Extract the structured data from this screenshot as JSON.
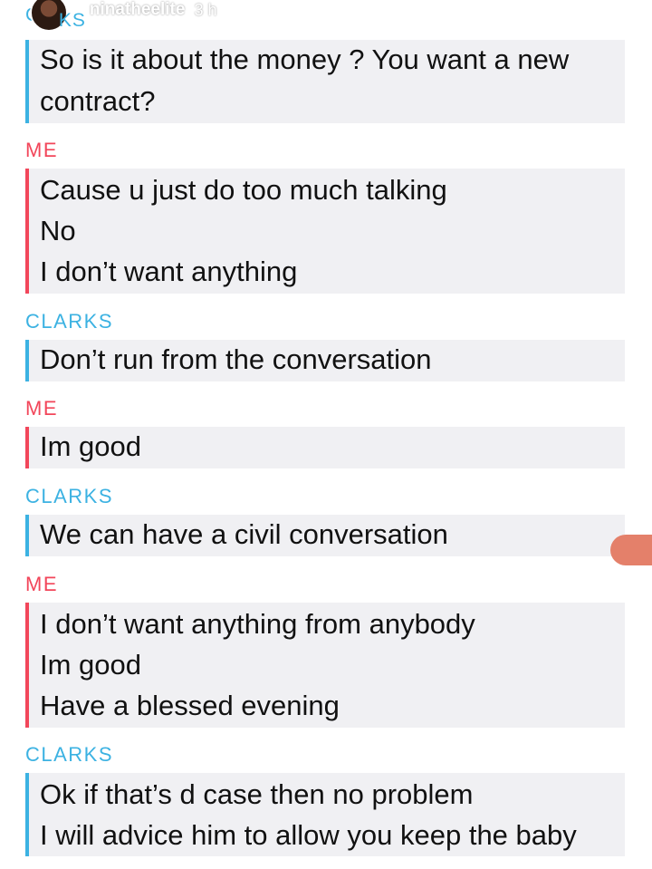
{
  "header": {
    "sender_partial_start": "CL",
    "sender_partial_end": "KS",
    "username": "ninatheelite",
    "time": "3 h"
  },
  "messages": [
    {
      "sender": "CLARKS",
      "lines": [
        "So is it about the money ? You want a new",
        "contract?"
      ]
    },
    {
      "sender": "ME",
      "lines": [
        "Cause u just do too much talking",
        "No",
        "I don’t want anything"
      ]
    },
    {
      "sender": "CLARKS",
      "lines": [
        "Don’t run from the conversation"
      ]
    },
    {
      "sender": "ME",
      "lines": [
        "Im good"
      ]
    },
    {
      "sender": "CLARKS",
      "lines": [
        "We can have a civil conversation"
      ]
    },
    {
      "sender": "ME",
      "lines": [
        "I don’t want anything from anybody",
        "Im good",
        "Have a blessed evening"
      ]
    },
    {
      "sender": "CLARKS",
      "lines": [
        "Ok if that’s d case then no problem",
        "I will advice him to allow you keep the baby"
      ]
    }
  ],
  "colors": {
    "clarks": "#3cb2e2",
    "me": "#f2465a",
    "bubble_bg": "#f0f0f3"
  }
}
